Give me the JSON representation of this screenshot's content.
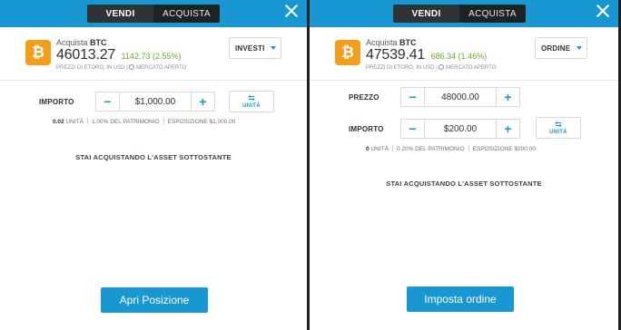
{
  "left": {
    "tabs": {
      "sell": "VENDI",
      "buy": "ACQUISTA"
    },
    "asset": {
      "action": "Acquista",
      "symbol": "BTC",
      "coin_glyph": "₿",
      "price": "46013.27",
      "change": "1142.73 (2.55%)",
      "note": "PREZZI DI ETORO, IN USD",
      "market": "MERCATO APERTO"
    },
    "order_type": "INVESTI",
    "amount": {
      "label": "IMPORTO",
      "value": "$1,000.00"
    },
    "units_btn": {
      "icon": "⇆",
      "label": "UNITÀ"
    },
    "meta": {
      "units_val": "0.02",
      "units_lbl": "UNITÀ",
      "equity": "1.00% DEL PATRIMONIO",
      "exposure": "ESPOSIZIONE $1,000.00"
    },
    "notice": "STAI ACQUISTANDO L'ASSET SOTTOSTANTE",
    "cta": "Apri Posizione"
  },
  "right": {
    "tabs": {
      "sell": "VENDI",
      "buy": "ACQUISTA"
    },
    "asset": {
      "action": "Acquista",
      "symbol": "BTC",
      "coin_glyph": "₿",
      "price": "47539.41",
      "change": "686.34 (1.46%)",
      "note": "PREZZI DI ETORO, IN USD",
      "market": "MERCATO APERTO"
    },
    "order_type": "ORDINE",
    "rate": {
      "label": "PREZZO",
      "value": "48000.00"
    },
    "amount": {
      "label": "IMPORTO",
      "value": "$200.00"
    },
    "units_btn": {
      "icon": "⇆",
      "label": "UNITÀ"
    },
    "meta": {
      "units_val": "0",
      "units_lbl": "UNITÀ",
      "equity": "0.20% DEL PATRIMONIO",
      "exposure": "ESPOSIZIONE $200.00"
    },
    "notice": "STAI ACQUISTANDO L'ASSET SOTTOSTANTE",
    "cta": "Imposta ordine"
  },
  "colors": {
    "brand": "#1897d2",
    "coin": "#f39d1a",
    "positive": "#6fa72f"
  }
}
